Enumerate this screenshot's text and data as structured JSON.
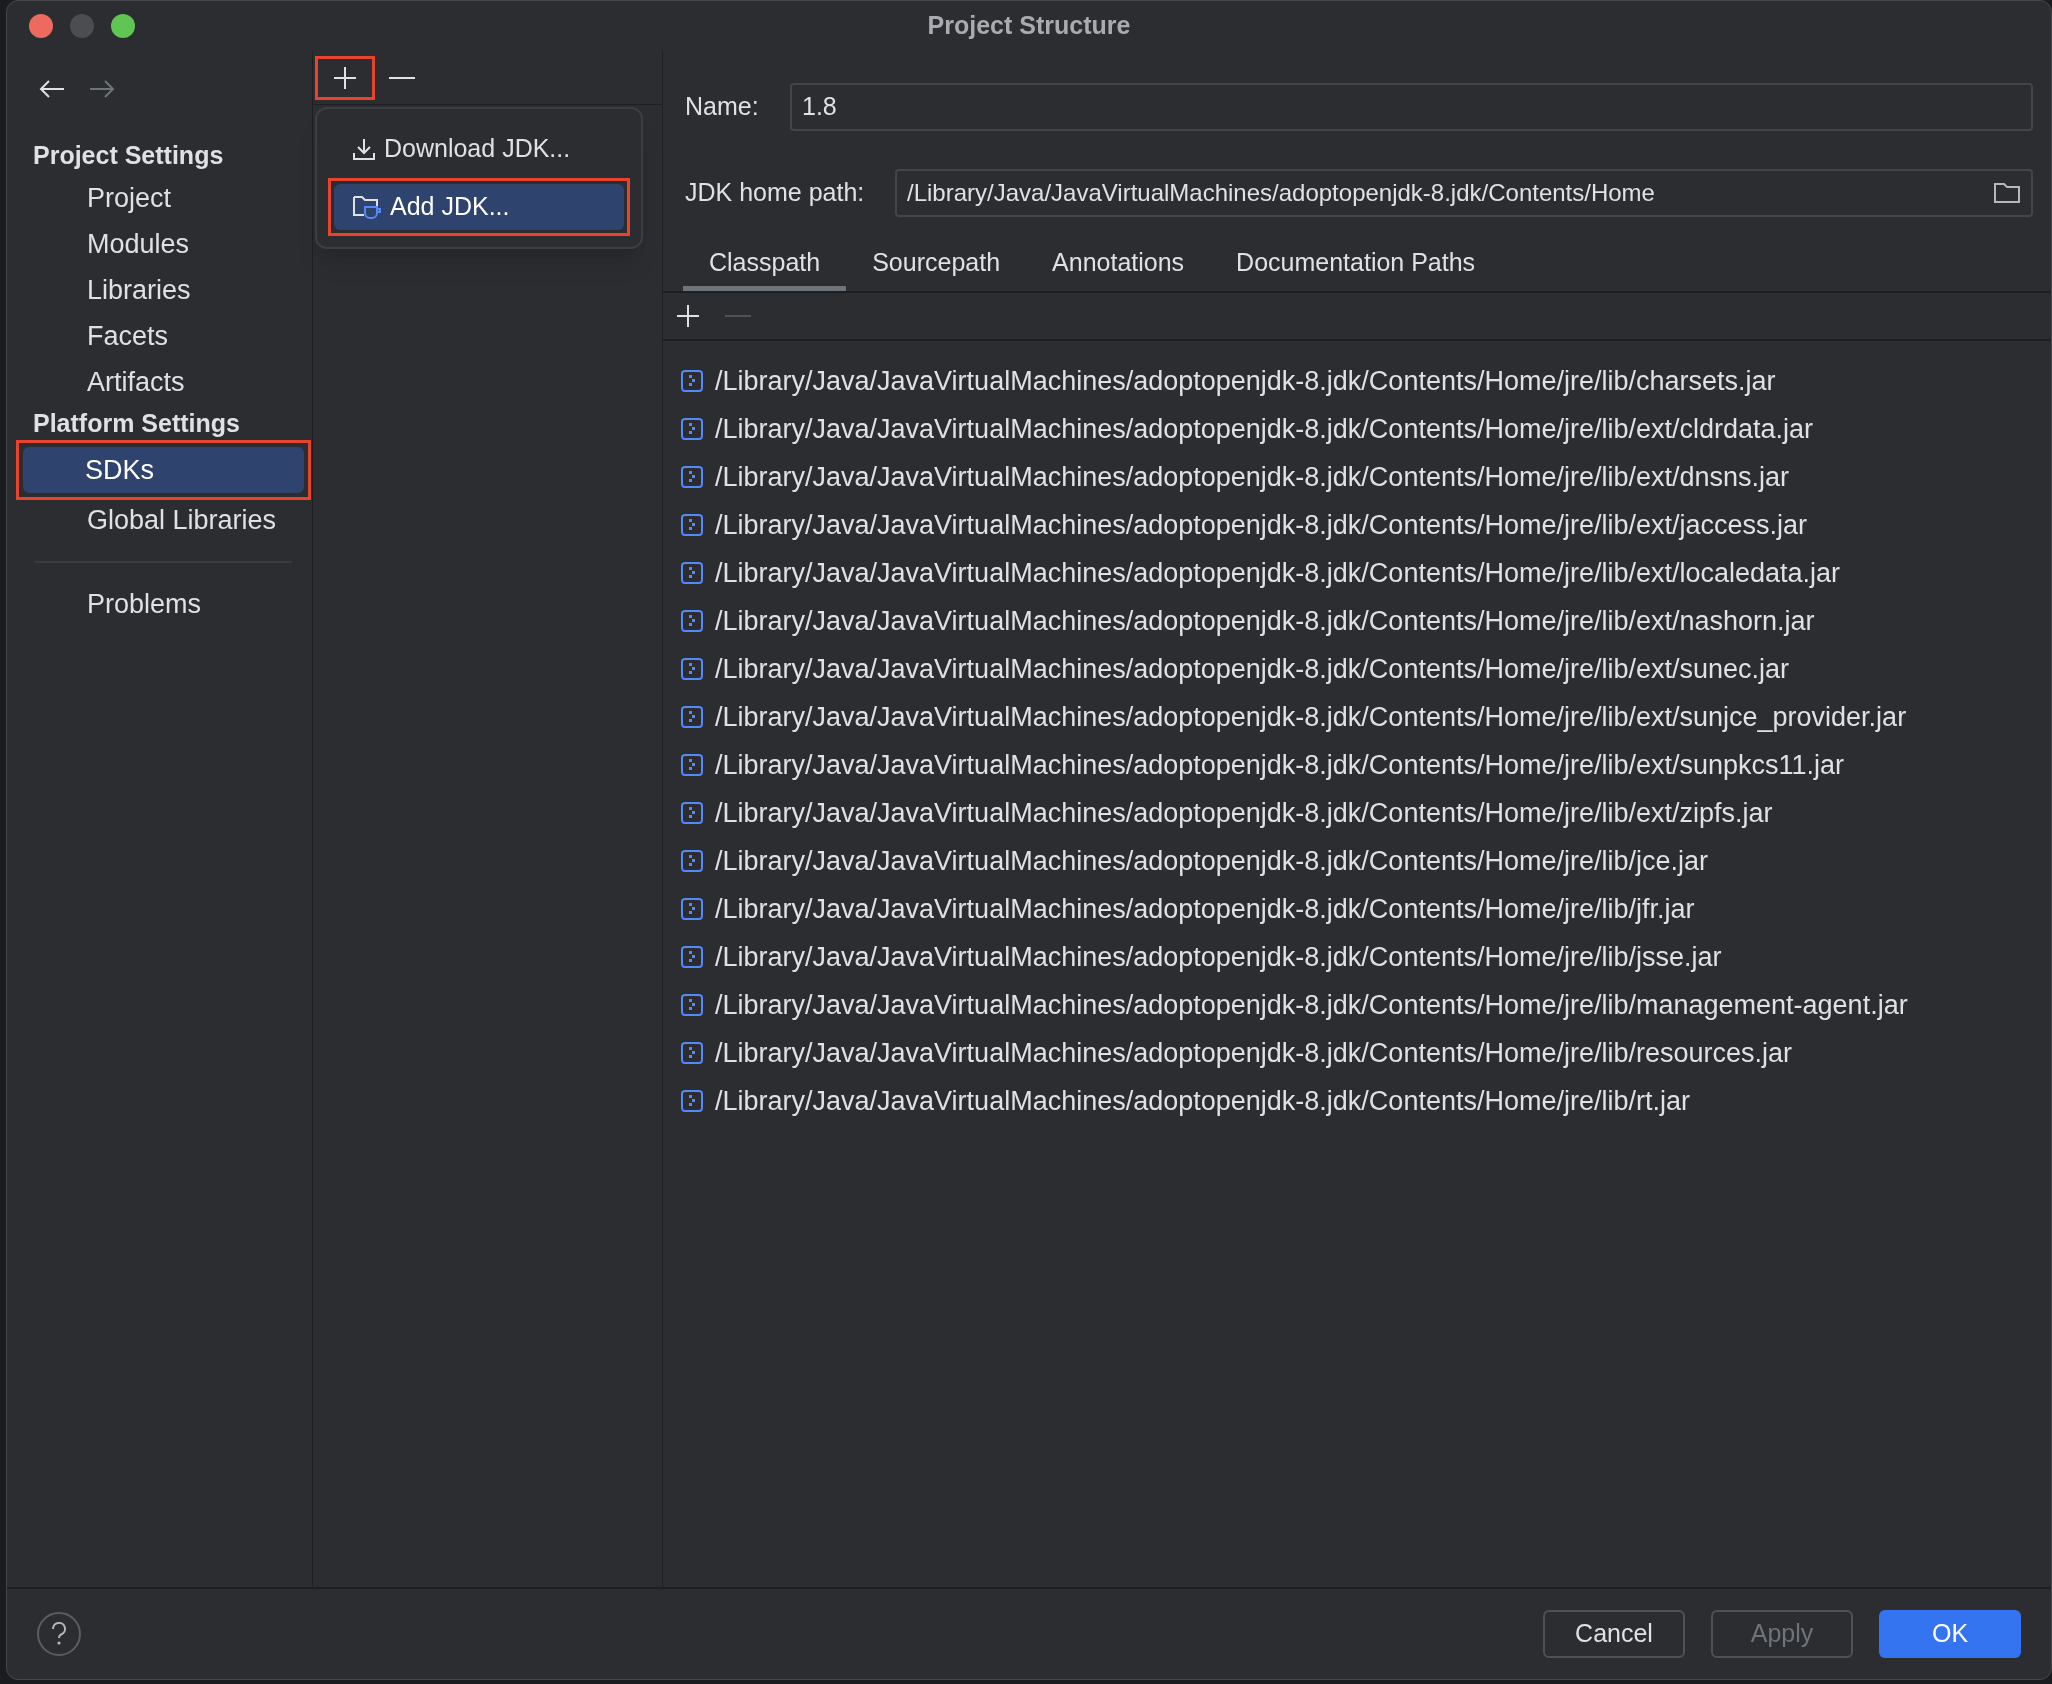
{
  "window": {
    "title": "Project Structure"
  },
  "sidebar": {
    "sections": [
      {
        "title": "Project Settings",
        "items": [
          {
            "label": "Project",
            "selected": false
          },
          {
            "label": "Modules",
            "selected": false
          },
          {
            "label": "Libraries",
            "selected": false
          },
          {
            "label": "Facets",
            "selected": false
          },
          {
            "label": "Artifacts",
            "selected": false
          }
        ]
      },
      {
        "title": "Platform Settings",
        "items": [
          {
            "label": "SDKs",
            "selected": true,
            "highlighted": true
          },
          {
            "label": "Global Libraries",
            "selected": false,
            "highlighted": false
          }
        ]
      }
    ],
    "bottom_items": [
      {
        "label": "Problems",
        "selected": false
      }
    ]
  },
  "add_menu": {
    "add_highlighted": true,
    "items": [
      {
        "label": "Download JDK...",
        "kind": "download",
        "selected": false,
        "highlighted": false
      },
      {
        "label": "Add JDK...",
        "kind": "folder",
        "selected": true,
        "highlighted": true
      }
    ]
  },
  "name": {
    "label": "Name:",
    "value": "1.8"
  },
  "home_path": {
    "label": "JDK home path:",
    "value": "/Library/Java/JavaVirtualMachines/adoptopenjdk-8.jdk/Contents/Home"
  },
  "tabs": [
    {
      "label": "Classpath",
      "selected": true
    },
    {
      "label": "Sourcepath",
      "selected": false
    },
    {
      "label": "Annotations",
      "selected": false
    },
    {
      "label": "Documentation Paths",
      "selected": false
    }
  ],
  "classpath": [
    "/Library/Java/JavaVirtualMachines/adoptopenjdk-8.jdk/Contents/Home/jre/lib/charsets.jar",
    "/Library/Java/JavaVirtualMachines/adoptopenjdk-8.jdk/Contents/Home/jre/lib/ext/cldrdata.jar",
    "/Library/Java/JavaVirtualMachines/adoptopenjdk-8.jdk/Contents/Home/jre/lib/ext/dnsns.jar",
    "/Library/Java/JavaVirtualMachines/adoptopenjdk-8.jdk/Contents/Home/jre/lib/ext/jaccess.jar",
    "/Library/Java/JavaVirtualMachines/adoptopenjdk-8.jdk/Contents/Home/jre/lib/ext/localedata.jar",
    "/Library/Java/JavaVirtualMachines/adoptopenjdk-8.jdk/Contents/Home/jre/lib/ext/nashorn.jar",
    "/Library/Java/JavaVirtualMachines/adoptopenjdk-8.jdk/Contents/Home/jre/lib/ext/sunec.jar",
    "/Library/Java/JavaVirtualMachines/adoptopenjdk-8.jdk/Contents/Home/jre/lib/ext/sunjce_provider.jar",
    "/Library/Java/JavaVirtualMachines/adoptopenjdk-8.jdk/Contents/Home/jre/lib/ext/sunpkcs11.jar",
    "/Library/Java/JavaVirtualMachines/adoptopenjdk-8.jdk/Contents/Home/jre/lib/ext/zipfs.jar",
    "/Library/Java/JavaVirtualMachines/adoptopenjdk-8.jdk/Contents/Home/jre/lib/jce.jar",
    "/Library/Java/JavaVirtualMachines/adoptopenjdk-8.jdk/Contents/Home/jre/lib/jfr.jar",
    "/Library/Java/JavaVirtualMachines/adoptopenjdk-8.jdk/Contents/Home/jre/lib/jsse.jar",
    "/Library/Java/JavaVirtualMachines/adoptopenjdk-8.jdk/Contents/Home/jre/lib/management-agent.jar",
    "/Library/Java/JavaVirtualMachines/adoptopenjdk-8.jdk/Contents/Home/jre/lib/resources.jar",
    "/Library/Java/JavaVirtualMachines/adoptopenjdk-8.jdk/Contents/Home/jre/lib/rt.jar"
  ],
  "buttons": [
    {
      "label": "Cancel",
      "kind": "secondary",
      "disabled": false
    },
    {
      "label": "Apply",
      "kind": "secondary",
      "disabled": true
    },
    {
      "label": "OK",
      "kind": "primary",
      "disabled": false
    }
  ]
}
